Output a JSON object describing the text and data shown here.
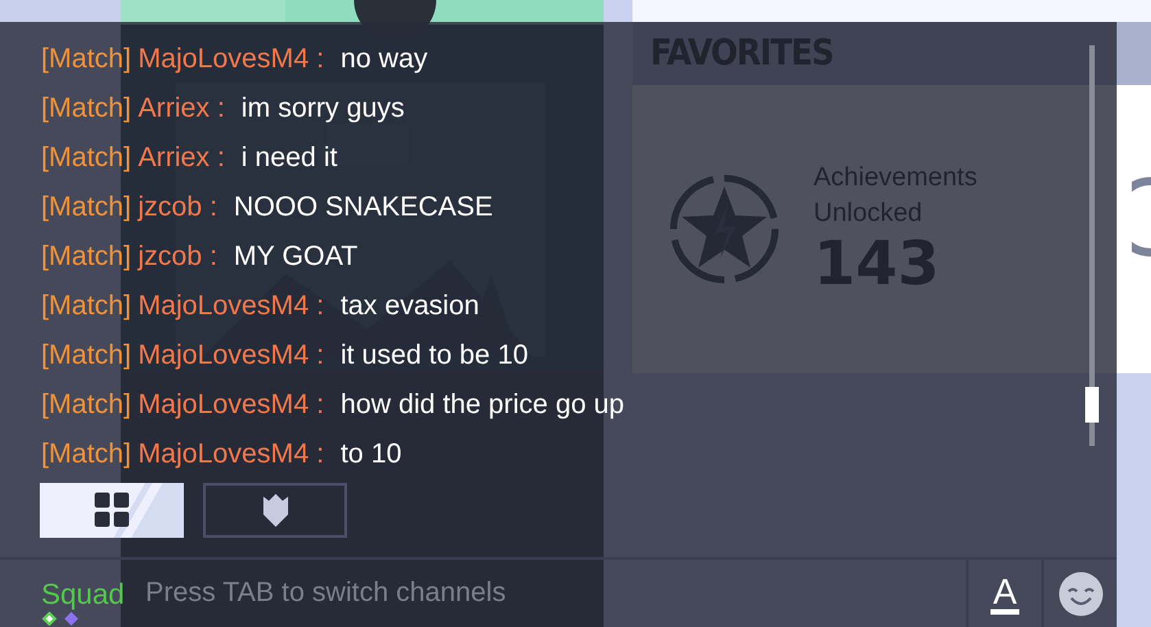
{
  "background": {
    "favorites": {
      "title": "FAVORITES",
      "stat_label": "Achievements Unlocked",
      "stat_value": "143"
    }
  },
  "chat": {
    "messages": [
      {
        "channel": "[Match]",
        "sender": "MajoLovesM4 :",
        "text": "no way"
      },
      {
        "channel": "[Match]",
        "sender": "Arriex :",
        "text": "im sorry guys"
      },
      {
        "channel": "[Match]",
        "sender": "Arriex :",
        "text": "i need it"
      },
      {
        "channel": "[Match]",
        "sender": "jzcob :",
        "text": "NOOO SNAKECASE"
      },
      {
        "channel": "[Match]",
        "sender": "jzcob :",
        "text": "MY GOAT"
      },
      {
        "channel": "[Match]",
        "sender": "MajoLovesM4 :",
        "text": "tax evasion"
      },
      {
        "channel": "[Match]",
        "sender": "MajoLovesM4 :",
        "text": "it used to be 10"
      },
      {
        "channel": "[Match]",
        "sender": "MajoLovesM4 :",
        "text": "how did the price go up"
      },
      {
        "channel": "[Match]",
        "sender": "MajoLovesM4 :",
        "text": "to 10"
      }
    ],
    "tabs": [
      {
        "kind": "grid",
        "selected": true
      },
      {
        "kind": "shield",
        "selected": false
      }
    ],
    "input": {
      "channel": "Squad",
      "placeholder": "Press TAB to switch channels"
    },
    "buttons": [
      {
        "kind": "text-style",
        "label": "A"
      },
      {
        "kind": "emoji"
      }
    ]
  }
}
